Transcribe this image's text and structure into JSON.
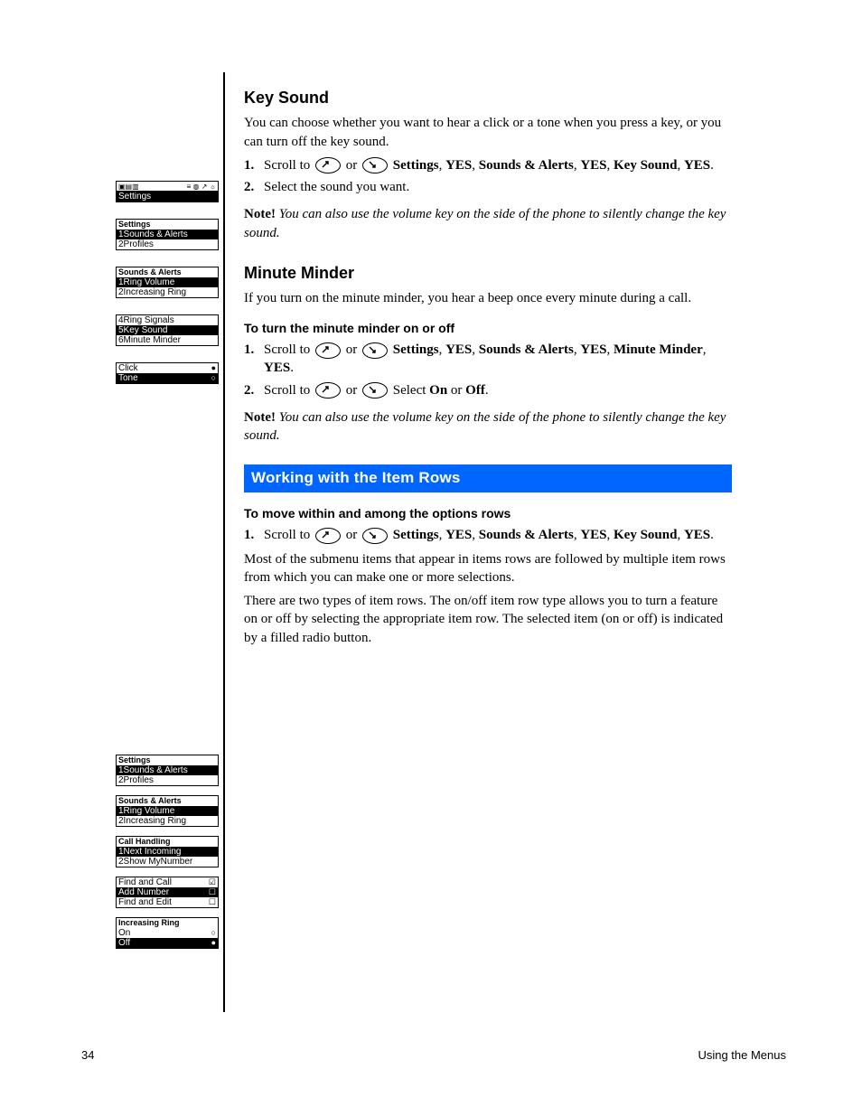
{
  "section1": {
    "title": "Key Sound",
    "intro": "You can choose whether you want to hear a click or a tone when you press a key, or you can turn off the key sound.",
    "steps": [
      "Scroll to Settings, YES, Sounds & Alerts, YES, Key Sound, YES.",
      "Select the sound you want."
    ],
    "note_label": "Note!",
    "note_text": " You can also use the volume key on the side of the phone to silently change the key sound."
  },
  "section2": {
    "title": "Minute Minder",
    "intro": "If you turn on the minute minder, you hear a beep once every minute during a call.",
    "subhead": "To turn the minute minder on or off",
    "steps": [
      "Scroll to Settings, YES, Sounds & Alerts, YES, Minute Minder, YES.",
      "Select On or Off."
    ]
  },
  "rows_title": "Working with the Item Rows",
  "section3": {
    "subhead": "To move within and among the options rows",
    "steps": [
      "Scroll to Settings, YES, Sounds & Alerts, YES, Key Sound, YES."
    ],
    "body": [
      "Most of the submenu items that appear in items rows are followed by multiple item rows from which you can make one or more selections.",
      "There are two types of item rows. The on/off item row type allows you to turn a feature on or off by selecting the appropriate item row. The selected item (on or off) is indicated by a filled radio button."
    ]
  },
  "footer": {
    "left": "34",
    "right": "Using the Menus"
  },
  "key_labels": {
    "up": "up-arrow-key",
    "down": "down-arrow-key",
    "yes": "YES",
    "settings": "Settings",
    "sounds": "Sounds & Alerts",
    "keysound": "Key Sound",
    "minute": "Minute Minder",
    "on": "On",
    "off": "Off"
  },
  "side_screens_top": [
    {
      "title": "",
      "rows": [
        {
          "t": "status"
        },
        {
          "t": "Settings",
          "sel": true
        }
      ]
    },
    {
      "title": "Settings",
      "rows": [
        {
          "t": "1Sounds & Alerts",
          "sel": true
        },
        {
          "t": "2Profiles",
          "sel": false
        }
      ]
    },
    {
      "title": "Sounds & Alerts",
      "rows": [
        {
          "t": "1Ring Volume",
          "sel": true
        },
        {
          "t": "2Increasing Ring",
          "sel": false
        }
      ]
    },
    {
      "title": "",
      "rows": [
        {
          "t": "4Ring Signals",
          "sel": false
        },
        {
          "t": "5Key Sound",
          "sel": true
        },
        {
          "t": "6Minute Minder",
          "sel": false
        }
      ]
    },
    {
      "title": "",
      "rows": [
        {
          "t": "Click",
          "sel": false,
          "mark": "dotf"
        },
        {
          "t": "Tone",
          "sel": true,
          "mark": "dot"
        }
      ]
    }
  ],
  "side_screens_bottom": [
    {
      "title": "Settings",
      "rows": [
        {
          "t": "1Sounds & Alerts",
          "sel": true
        },
        {
          "t": "2Profiles",
          "sel": false
        }
      ]
    },
    {
      "title": "Sounds & Alerts",
      "rows": [
        {
          "t": "1Ring Volume",
          "sel": true
        },
        {
          "t": "2Increasing Ring",
          "sel": false
        }
      ]
    },
    {
      "title": "Call Handling",
      "rows": [
        {
          "t": "1Next Incoming",
          "sel": true
        },
        {
          "t": "2Show MyNumber",
          "sel": false
        }
      ]
    },
    {
      "title": "",
      "rows": [
        {
          "t": "Find and Call",
          "sel": false,
          "mark": "chk"
        },
        {
          "t": "Add Number",
          "sel": true,
          "mark": "box"
        },
        {
          "t": "Find and Edit",
          "sel": false,
          "mark": "box"
        }
      ]
    },
    {
      "title": "Increasing Ring",
      "rows": [
        {
          "t": "On",
          "sel": false,
          "mark": "dot"
        },
        {
          "t": "Off",
          "sel": true,
          "mark": "dotf"
        }
      ]
    }
  ]
}
